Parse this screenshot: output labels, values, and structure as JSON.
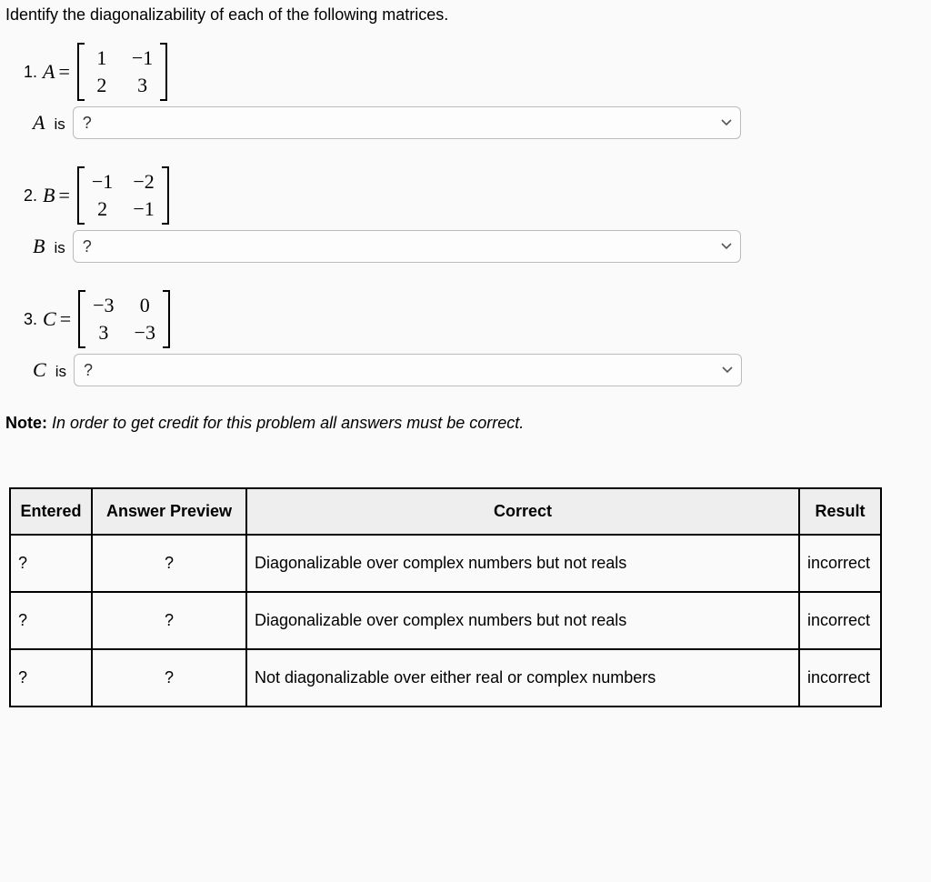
{
  "intro": "Identify the diagonalizability of each of the following matrices.",
  "items": [
    {
      "num": "1.",
      "var": "A",
      "m": [
        "1",
        "−1",
        "2",
        "3"
      ],
      "select_value": "?"
    },
    {
      "num": "2.",
      "var": "B",
      "m": [
        "−1",
        "−2",
        "2",
        "−1"
      ],
      "select_value": "?"
    },
    {
      "num": "3.",
      "var": "C",
      "m": [
        "−3",
        "0",
        "3",
        "−3"
      ],
      "select_value": "?"
    }
  ],
  "is_text": "is",
  "eq_text": "=",
  "note_label": "Note",
  "note_text": "In order to get credit for this problem all answers must be correct.",
  "table": {
    "headers": [
      "Entered",
      "Answer Preview",
      "Correct",
      "Result"
    ],
    "rows": [
      {
        "entered": "?",
        "preview": "?",
        "correct": "Diagonalizable over complex numbers but not reals",
        "result": "incorrect"
      },
      {
        "entered": "?",
        "preview": "?",
        "correct": "Diagonalizable over complex numbers but not reals",
        "result": "incorrect"
      },
      {
        "entered": "?",
        "preview": "?",
        "correct": "Not diagonalizable over either real or complex numbers",
        "result": "incorrect"
      }
    ]
  }
}
